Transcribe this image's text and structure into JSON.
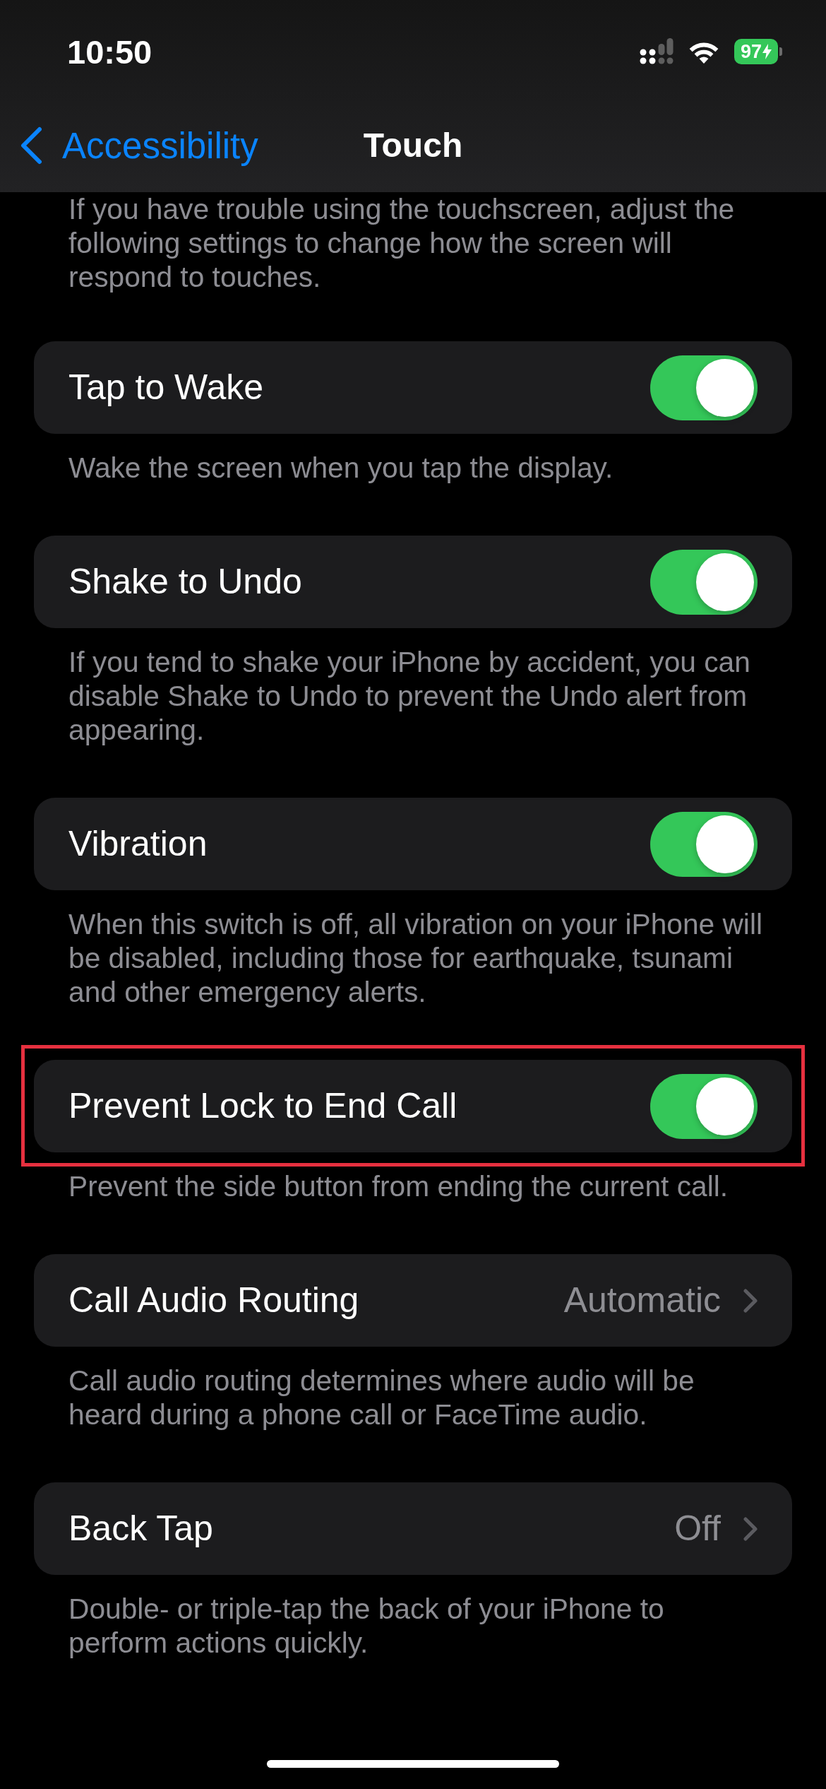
{
  "status_bar": {
    "time": "10:50",
    "battery": "97"
  },
  "nav": {
    "back": "Accessibility",
    "title": "Touch"
  },
  "intro": "If you have trouble using the touchscreen, adjust the following settings to change how the screen will respond to touches.",
  "rows": [
    {
      "kind": "toggle",
      "label": "Tap to Wake",
      "on": true,
      "highlighted": false,
      "footer": "Wake the screen when you tap the display."
    },
    {
      "kind": "toggle",
      "label": "Shake to Undo",
      "on": true,
      "highlighted": false,
      "footer": "If you tend to shake your iPhone by accident, you can disable Shake to Undo to prevent the Undo alert from appearing."
    },
    {
      "kind": "toggle",
      "label": "Vibration",
      "on": true,
      "highlighted": false,
      "footer": "When this switch is off, all vibration on your iPhone will be disabled, including those for earthquake, tsunami and other emergency alerts."
    },
    {
      "kind": "toggle",
      "label": "Prevent Lock to End Call",
      "on": true,
      "highlighted": true,
      "footer": "Prevent the side button from ending the current call."
    },
    {
      "kind": "link",
      "label": "Call Audio Routing",
      "value": "Automatic",
      "highlighted": false,
      "footer": "Call audio routing determines where audio will be heard during a phone call or FaceTime audio."
    },
    {
      "kind": "link",
      "label": "Back Tap",
      "value": "Off",
      "highlighted": false,
      "footer": "Double- or triple-tap the back of your iPhone to perform actions quickly."
    }
  ]
}
